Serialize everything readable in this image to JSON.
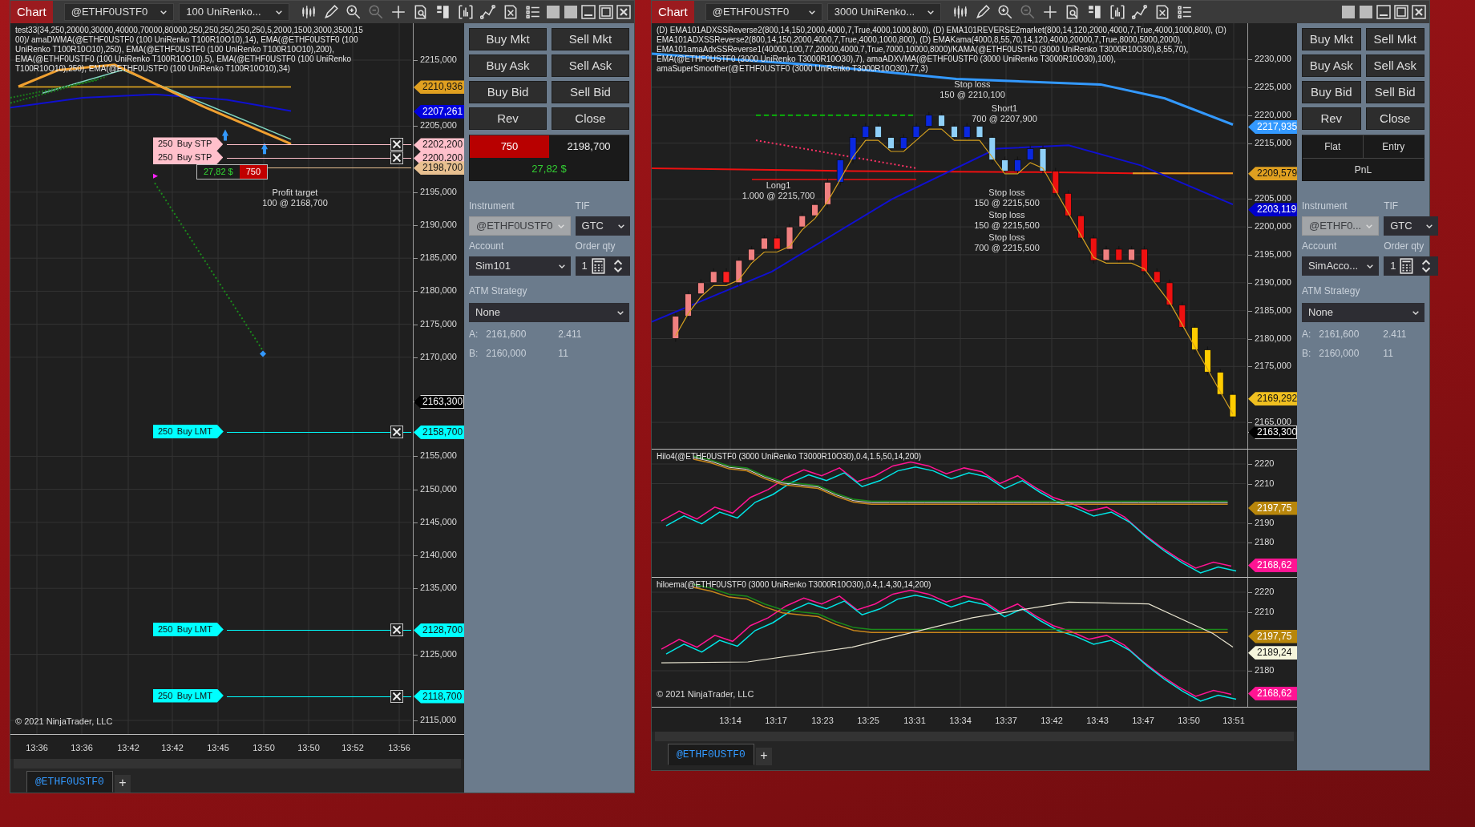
{
  "windows": [
    {
      "title": "Chart",
      "instrument": "@ETHF0USTF0",
      "bar_type": "100 UniRenko...",
      "panes": [
        {
          "title": "test33(34,250,20000,30000,40000,70000,80000,250,250,250,250,250,5,2000,1500,3000,3500,1500)/ amaDWMA(@ETHF0USTF0 (100 UniRenko T100R10O10),14), EMA(@ETHF0USTF0 (100 UniRenko T100R10O10),250), EMA(@ETHF0USTF0 (100 UniRenko T100R10O10),200), EMA(@ETHF0USTF0 (100 UniRenko T100R10O10),5), EMA(@ETHF0USTF0 (100 UniRenko T100R10O10),250), EMA(@ETHF0USTF0 (100 UniRenko T100R10O10),34)",
          "annotations": [
            {
              "lines": [
                "Profit target",
                "100 @ 2168,700"
              ]
            }
          ],
          "order_lines": [
            {
              "quantity": "250",
              "order_type": "Buy STP",
              "price": "2202,200",
              "color": "#ffc0cb"
            },
            {
              "quantity": "250",
              "order_type": "Buy STP",
              "price": "2200,200",
              "color": "#ffc0cb"
            },
            {
              "quantity": "250",
              "order_type": "Buy LMT",
              "price": "2158,700",
              "color": "#00ffff"
            },
            {
              "quantity": "250",
              "order_type": "Buy LMT",
              "price": "2128,700",
              "color": "#00ffff"
            },
            {
              "quantity": "250",
              "order_type": "Buy LMT",
              "price": "2118,700",
              "color": "#00ffff"
            }
          ],
          "position": {
            "pnl": "27,82 $",
            "quantity": "750",
            "price": "2198,700"
          },
          "axis_ticks": [
            "2215,000",
            "2205,000",
            "2195,000",
            "2190,000",
            "2185,000",
            "2180,000",
            "2175,000",
            "2170,000",
            "2155,000",
            "2150,000",
            "2145,000",
            "2140,000",
            "2135,000",
            "2125,000",
            "2115,000"
          ],
          "axis_markers": [
            {
              "label": "2210,936",
              "color": "#e0a020"
            },
            {
              "label": "2207,261",
              "color": "#0000dd"
            },
            {
              "label": "2163,300",
              "color": "#000000"
            }
          ],
          "copyright": "© 2021 NinjaTrader, LLC"
        }
      ],
      "time_axis": [
        "13:36",
        "13:36",
        "13:42",
        "13:42",
        "13:45",
        "13:50",
        "13:50",
        "13:52",
        "13:56"
      ],
      "tabs": [
        {
          "label": "@ETHF0USTF0",
          "selected": true
        }
      ],
      "add_tab": "+",
      "order_panel": {
        "buttons": [
          "Buy Mkt",
          "Sell Mkt",
          "Buy Ask",
          "Sell Ask",
          "Buy Bid",
          "Sell Bid",
          "Rev",
          "Close"
        ],
        "position": {
          "kind": "open",
          "quantity": "750",
          "average_price": "2198,700",
          "pnl": "27,82 $"
        },
        "instrument_label": "Instrument",
        "instrument": {
          "value": "@ETHF0USTF0",
          "disabled": true
        },
        "tif_label": "TIF",
        "tif": "GTC",
        "account_label": "Account",
        "account": "Sim101",
        "qty_label": "Order qty",
        "qty": "1",
        "atm_label": "ATM Strategy",
        "atm": "None",
        "ask": {
          "label": "A:",
          "price": "2161,600",
          "size": "2.411"
        },
        "bid": {
          "label": "B:",
          "price": "2160,000",
          "size": "11"
        }
      }
    },
    {
      "title": "Chart",
      "instrument": "@ETHF0USTF0",
      "bar_type": "3000 UniRenko...",
      "panes": [
        {
          "title": "(D) EMA101ADXSSReverse2(800,14,150,2000,4000,7,True,4000,1000,800), (D) EMA101REVERSE2market(800,14,120,2000,4000,7,True,4000,1000,800), (D) EMA101ADXSSReverse2(800,14,150,2000,4000,7,True,4000,1000,800), (D) EMAKama(4000,8,55,70,14,120,4000,20000,7,True,8000,5000,2000), EMA101amaAdxSSReverse1(40000,100,77,20000,4000,7,True,7000,10000,8000)/KAMA(@ETHF0USTF0 (3000 UniRenko T3000R10O30),8,55,70), EMA(@ETHF0USTF0 (3000 UniRenko T3000R10O30),7), amaADXVMA(@ETHF0USTF0 (3000 UniRenko T3000R10O30),100), amaSuperSmoother(@ETHF0USTF0 (3000 UniRenko T3000R10O30),77,3)",
          "annotations": [
            {
              "lines": [
                "Stop loss",
                "150 @ 2210,100"
              ]
            },
            {
              "lines": [
                "Long1",
                "1.000 @ 2215,700"
              ]
            },
            {
              "lines": [
                "Short1",
                "700 @ 2207,900"
              ]
            },
            {
              "lines": [
                "Stop loss",
                "150 @ 2215,500"
              ]
            },
            {
              "lines": [
                "Stop loss",
                "150 @ 2215,500"
              ]
            },
            {
              "lines": [
                "Stop loss",
                "700 @ 2215,500"
              ]
            }
          ],
          "axis_ticks": [
            "2230,000",
            "2225,000",
            "2220,000",
            "2215,000",
            "2205,000",
            "2200,000",
            "2195,000",
            "2190,000",
            "2185,000",
            "2180,000",
            "2175,000",
            "2165,000"
          ],
          "axis_markers": [
            {
              "label": "2217,935",
              "color": "#3399ff"
            },
            {
              "label": "2209,579",
              "color": "#e0a020"
            },
            {
              "label": "2203,119",
              "color": "#0000cc"
            },
            {
              "label": "2169,292",
              "color": "#f0c020"
            },
            {
              "label": "2163,300",
              "color": "#000000"
            }
          ]
        },
        {
          "title": "Hilo4(@ETHF0USTF0 (3000 UniRenko T3000R10O30),0.4,1.5,50,14,200)",
          "axis_ticks": [
            "2220",
            "2210",
            "2190",
            "2180"
          ],
          "axis_markers": [
            {
              "label": "2197,75",
              "color": "#b8860b"
            },
            {
              "label": "2168,62",
              "color": "#ff1493"
            }
          ]
        },
        {
          "title": "hiloema(@ETHF0USTF0 (3000 UniRenko T3000R10O30),0.4,1.4,30,14,200)",
          "axis_ticks": [
            "2220",
            "2210",
            "2180"
          ],
          "axis_markers": [
            {
              "label": "2197,75",
              "color": "#b8860b"
            },
            {
              "label": "2189,24",
              "color": "#f5f5dc"
            },
            {
              "label": "2168,62",
              "color": "#ff1493"
            }
          ],
          "copyright": "© 2021 NinjaTrader, LLC"
        }
      ],
      "time_axis": [
        "13:14",
        "13:17",
        "13:23",
        "13:25",
        "13:31",
        "13:34",
        "13:37",
        "13:42",
        "13:43",
        "13:47",
        "13:50",
        "13:51"
      ],
      "tabs": [
        {
          "label": "@ETHF0USTF0",
          "selected": true
        }
      ],
      "add_tab": "+",
      "order_panel": {
        "buttons": [
          "Buy Mkt",
          "Sell Mkt",
          "Buy Ask",
          "Sell Ask",
          "Buy Bid",
          "Sell Bid",
          "Rev",
          "Close"
        ],
        "position": {
          "kind": "flat",
          "quantity": "Flat",
          "average_price": "Entry",
          "pnl": "PnL"
        },
        "instrument_label": "Instrument",
        "instrument": {
          "value": "@ETHF0...",
          "disabled": true
        },
        "tif_label": "TIF",
        "tif": "GTC",
        "account_label": "Account",
        "account": "SimAcco...",
        "qty_label": "Order qty",
        "qty": "1",
        "atm_label": "ATM Strategy",
        "atm": "None",
        "ask": {
          "label": "A:",
          "price": "2161,600",
          "size": "2.411"
        },
        "bid": {
          "label": "B:",
          "price": "2160,000",
          "size": "11"
        }
      }
    }
  ]
}
